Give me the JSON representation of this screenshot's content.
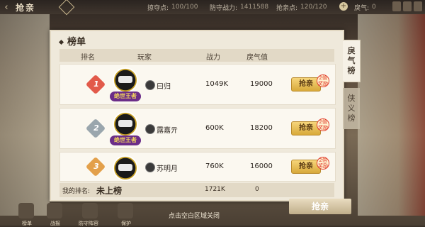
{
  "topbar": {
    "title": "抢亲",
    "stats": [
      {
        "label": "掠夺点:",
        "value": "100/100"
      },
      {
        "label": "防守战力:",
        "value": "1411588"
      },
      {
        "label": "抢亲点:",
        "value": "120/120"
      },
      {
        "label": "戾气:",
        "value": "0"
      }
    ]
  },
  "panel": {
    "title": "榜单",
    "columns": {
      "rank": "排名",
      "player": "玩家",
      "power": "战力",
      "violence": "戾气值"
    },
    "rows": [
      {
        "rank": "1",
        "name": "曰归",
        "power": "1049K",
        "violence": "19000",
        "action": "抢亲",
        "badge": "2倍奖励",
        "title_tag": "绝世王者",
        "rank_color": "#e25a4a"
      },
      {
        "rank": "2",
        "name": "露嘉亓",
        "power": "600K",
        "violence": "18200",
        "action": "抢亲",
        "badge": "2倍奖励",
        "title_tag": "绝世王者",
        "rank_color": "#9aa6ad"
      },
      {
        "rank": "3",
        "name": "苏明月",
        "power": "760K",
        "violence": "16000",
        "action": "抢亲",
        "badge": "2倍奖励",
        "title_tag": "",
        "rank_color": "#e3a04a"
      }
    ],
    "my_rank": {
      "label": "我的排名:",
      "value": "未上榜",
      "power": "1721K",
      "violence": "0"
    }
  },
  "tabs": [
    {
      "label": "戾气榜",
      "active": true
    },
    {
      "label": "侠义榜",
      "active": false
    }
  ],
  "bottom": {
    "items": [
      "榜单",
      "战报",
      "防守阵容",
      "保护"
    ],
    "hint": "点击空白区域关闭",
    "grab_button": "抢亲"
  }
}
